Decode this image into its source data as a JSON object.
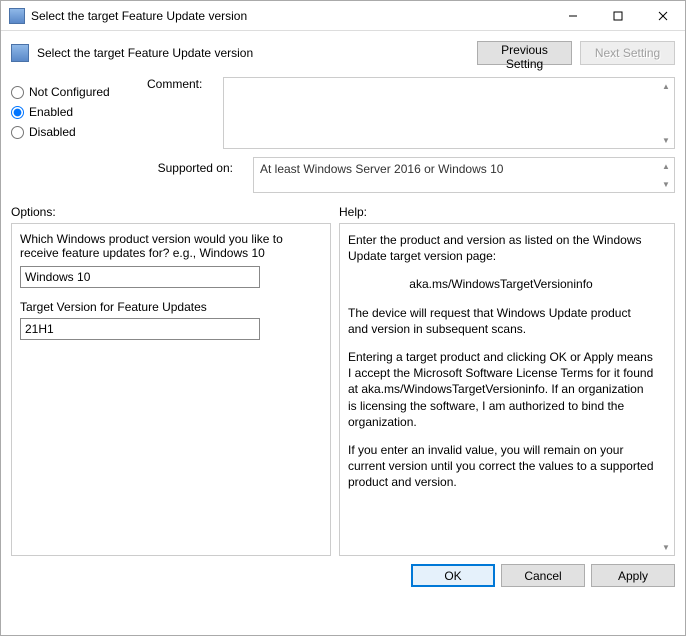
{
  "window": {
    "title": "Select the target Feature Update version"
  },
  "header": {
    "title": "Select the target Feature Update version",
    "prev_label": "Previous Setting",
    "next_label": "Next Setting"
  },
  "state": {
    "not_configured_label": "Not Configured",
    "enabled_label": "Enabled",
    "disabled_label": "Disabled",
    "selected": "Enabled"
  },
  "comment": {
    "label": "Comment:",
    "value": ""
  },
  "supported": {
    "label": "Supported on:",
    "value": "At least Windows Server 2016 or Windows 10"
  },
  "labels": {
    "options": "Options:",
    "help": "Help:"
  },
  "options": {
    "product_prompt": "Which Windows product version would you like to receive feature updates for? e.g., Windows 10",
    "product_value": "Windows 10",
    "target_label": "Target Version for Feature Updates",
    "target_value": "21H1"
  },
  "help": {
    "p1": "Enter the product and version as listed on the Windows Update target version page:",
    "link": "aka.ms/WindowsTargetVersioninfo",
    "p2": "The device will request that Windows Update product and version in subsequent scans.",
    "p3": "Entering a target product and clicking OK or Apply means I accept the Microsoft Software License Terms for it found at aka.ms/WindowsTargetVersioninfo. If an organization is licensing the software, I am authorized to bind the organization.",
    "p4": "If you enter an invalid value, you will remain on your current version until you correct the values to a supported product and version."
  },
  "footer": {
    "ok": "OK",
    "cancel": "Cancel",
    "apply": "Apply"
  }
}
